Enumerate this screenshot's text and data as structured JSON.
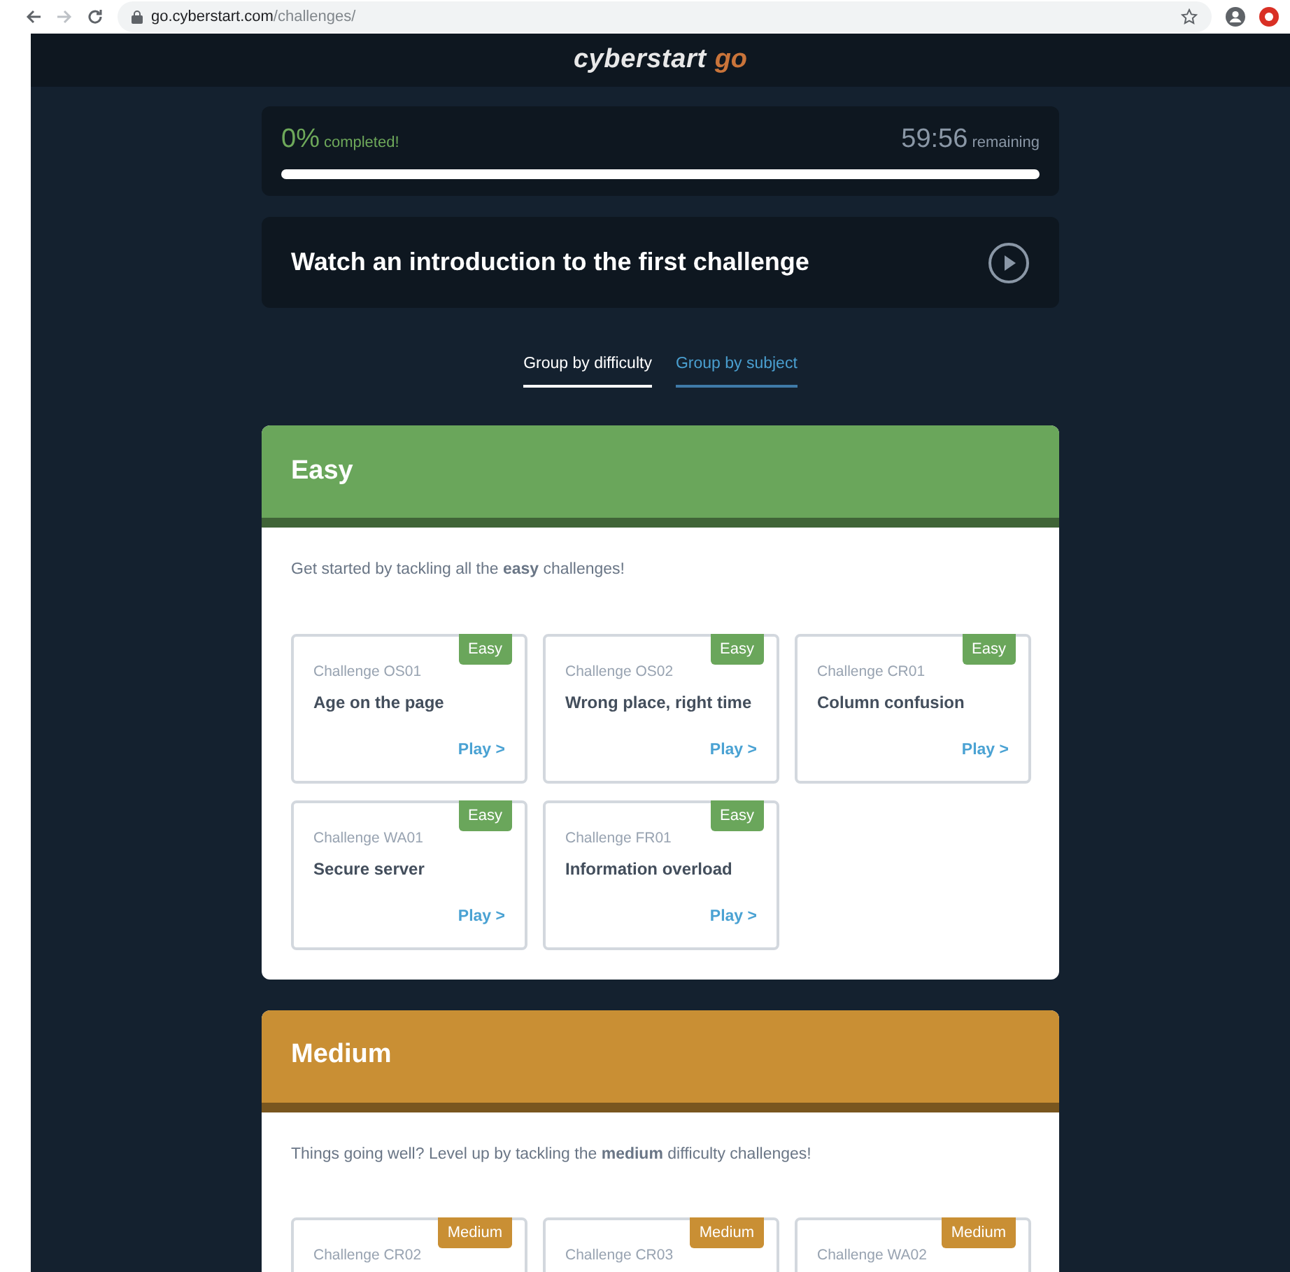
{
  "browser": {
    "url_host": "go.cyberstart.com",
    "url_path": "/challenges/"
  },
  "logo": {
    "primary": "cyberstart",
    "secondary": "go"
  },
  "progress": {
    "percent": "0%",
    "percent_label": "completed!",
    "time": "59:56",
    "time_label": "remaining",
    "level": 0
  },
  "intro": {
    "title": "Watch an introduction to the first challenge"
  },
  "tabs": [
    {
      "label": "Group by difficulty",
      "selected": true
    },
    {
      "label": "Group by subject",
      "selected": false
    }
  ],
  "sections": [
    {
      "title": "Easy",
      "color": "#6aa65b",
      "description": "Get started by tackling all the **easy** challenges!",
      "challenges": [
        {
          "code": "Challenge OS01",
          "title": "Age on the page",
          "badge": "Easy",
          "link": "Play >"
        },
        {
          "code": "Challenge OS02",
          "title": "Wrong place, right time",
          "badge": "Easy",
          "link": "Play >"
        },
        {
          "code": "Challenge CR01",
          "title": "Column confusion",
          "badge": "Easy",
          "link": "Play >"
        },
        {
          "code": "Challenge WA01",
          "title": "Secure server",
          "badge": "Easy",
          "link": "Play >"
        },
        {
          "code": "Challenge FR01",
          "title": "Information overload",
          "badge": "Easy",
          "link": "Play >"
        }
      ]
    },
    {
      "title": "Medium",
      "color": "#c98f34",
      "description": "Things going well? Level up by tackling the **medium** difficulty challenges!",
      "challenges": [
        {
          "code": "Challenge CR02",
          "badge": "Medium"
        },
        {
          "code": "Challenge CR03",
          "badge": "Medium"
        },
        {
          "code": "Challenge WA02",
          "badge": "Medium"
        }
      ]
    }
  ]
}
